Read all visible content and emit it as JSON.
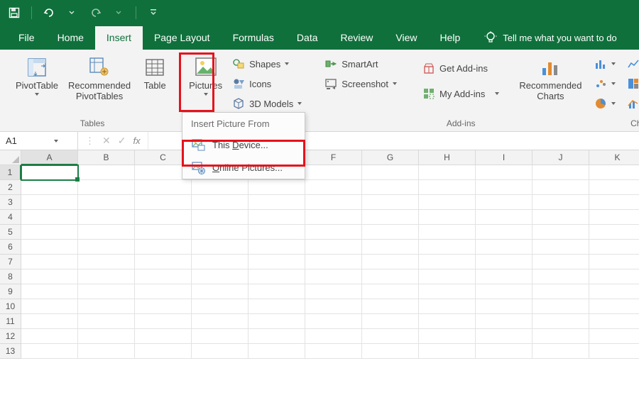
{
  "qat": {
    "save_tip": "Save",
    "undo_tip": "Undo",
    "redo_tip": "Redo",
    "customize_tip": "Customize"
  },
  "tabs": {
    "file": "File",
    "home": "Home",
    "insert": "Insert",
    "pagelayout": "Page Layout",
    "formulas": "Formulas",
    "data": "Data",
    "review": "Review",
    "view": "View",
    "help": "Help",
    "tellme": "Tell me what you want to do"
  },
  "ribbon": {
    "tables": {
      "pivot": "PivotTable",
      "recpivot": "Recommended\nPivotTables",
      "table": "Table",
      "group": "Tables"
    },
    "illustrations": {
      "pictures": "Pictures",
      "shapes": "Shapes",
      "icons": "Icons",
      "models": "3D Models",
      "smartart": "SmartArt",
      "screenshot": "Screenshot"
    },
    "addins": {
      "get": "Get Add-ins",
      "my": "My Add-ins",
      "group": "Add-ins"
    },
    "charts": {
      "rec": "Recommended\nCharts",
      "group": "Ch"
    }
  },
  "flyout": {
    "title": "Insert Picture From",
    "device_prefix": "This ",
    "device_key": "D",
    "device_suffix": "evice...",
    "online_key": "O",
    "online_suffix": "nline Pictures..."
  },
  "fx": {
    "namebox": "A1",
    "cancel": "✕",
    "enter": "✓",
    "fx": "fx"
  },
  "grid": {
    "cols": [
      "A",
      "B",
      "C",
      "D",
      "E",
      "F",
      "G",
      "H",
      "I",
      "J",
      "K"
    ],
    "rows": [
      "1",
      "2",
      "3",
      "4",
      "5",
      "6",
      "7",
      "8",
      "9",
      "10",
      "11",
      "12",
      "13"
    ],
    "selected": "A1"
  },
  "colors": {
    "brand": "#0f703b",
    "highlight": "#e5121c",
    "select": "#1a7f45"
  }
}
